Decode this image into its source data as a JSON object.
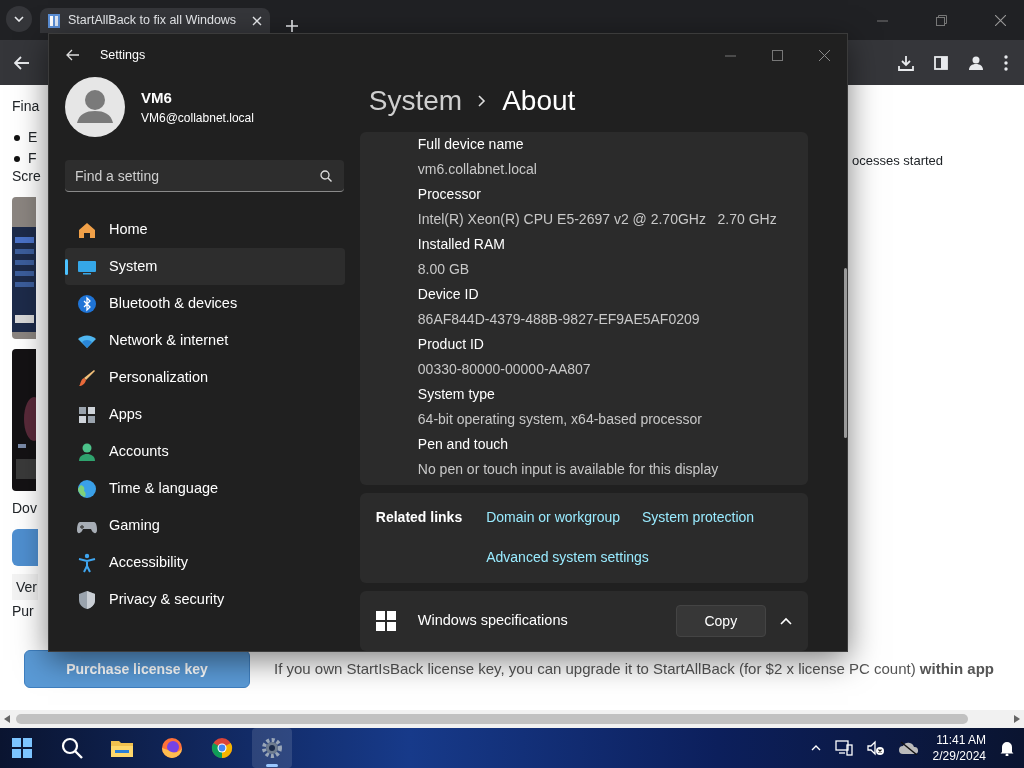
{
  "browser": {
    "tab": {
      "title": "StartAllBack to fix all Windows",
      "selected": true
    }
  },
  "page": {
    "fragments": [
      {
        "kind": "heading",
        "text": "Fina"
      },
      {
        "kind": "bullet",
        "text": "E"
      },
      {
        "kind": "bullet",
        "text": "F"
      },
      {
        "kind": "heading",
        "text": "Scre"
      },
      {
        "kind": "picture"
      },
      {
        "kind": "picture"
      },
      {
        "kind": "heading",
        "text": "Dov"
      },
      {
        "kind": "button"
      },
      {
        "kind": "text",
        "text": "Ver"
      },
      {
        "kind": "heading",
        "text": "Pur"
      }
    ],
    "right_fragment": "ocesses started",
    "purchase_button": "Purchase license key",
    "upgrade_note": "If you own StartIsBack license key, you can upgrade it to StartAllBack (for $2 x license PC count) **within app**"
  },
  "settings": {
    "title": "Settings",
    "user": {
      "name": "VM6",
      "email": "VM6@collabnet.local"
    },
    "search": {
      "placeholder": "Find a setting"
    },
    "nav": [
      {
        "label": "Home",
        "selected": false
      },
      {
        "label": "System",
        "selected": true
      },
      {
        "label": "Bluetooth & devices",
        "selected": false
      },
      {
        "label": "Network & internet",
        "selected": false
      },
      {
        "label": "Personalization",
        "selected": false
      },
      {
        "label": "Apps",
        "selected": false
      },
      {
        "label": "Accounts",
        "selected": false
      },
      {
        "label": "Time & language",
        "selected": false
      },
      {
        "label": "Gaming",
        "selected": false
      },
      {
        "label": "Accessibility",
        "selected": false
      },
      {
        "label": "Privacy & security",
        "selected": false
      }
    ],
    "breadcrumb": [
      "System",
      "About"
    ],
    "specs": [
      {
        "label": "Full device name",
        "value": "vm6.collabnet.local"
      },
      {
        "label": "Processor",
        "value": "Intel(R) Xeon(R) CPU E5-2697 v2 @ 2.70GHz   2.70 GHz"
      },
      {
        "label": "Installed RAM",
        "value": "8.00 GB"
      },
      {
        "label": "Device ID",
        "value": "86AF844D-4379-488B-9827-EF9AE5AF0209"
      },
      {
        "label": "Product ID",
        "value": "00330-80000-00000-AA807"
      },
      {
        "label": "System type",
        "value": "64-bit operating system, x64-based processor"
      },
      {
        "label": "Pen and touch",
        "value": "No pen or touch input is available for this display"
      }
    ],
    "related": {
      "title": "Related links",
      "links": [
        "Domain or workgroup",
        "System protection",
        "Advanced system settings"
      ]
    },
    "windows_specs": {
      "title": "Windows specifications",
      "button": "Copy",
      "expanded": true
    }
  },
  "taskbar": {
    "apps": [
      {
        "selected": false
      },
      {
        "selected": false
      },
      {
        "selected": false
      },
      {
        "selected": false
      },
      {
        "selected": false
      },
      {
        "selected": true
      }
    ],
    "clock": {
      "time": "11:41 AM",
      "date": "2/29/2024"
    }
  }
}
